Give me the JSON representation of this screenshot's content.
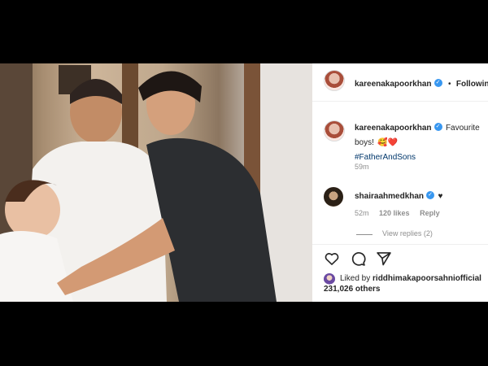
{
  "post": {
    "author": "kareenakapoorkhan",
    "follow_sep": "•",
    "follow_label": "Following"
  },
  "caption": {
    "author": "kareenakapoorkhan",
    "text": "Favourite boys!",
    "emoji1": "🥰",
    "emoji2": "❤️",
    "hashtag": "#FatherAndSons",
    "time": "59m"
  },
  "comment": {
    "author": "shairaahmedkhan",
    "text": "♥",
    "time": "52m",
    "likes": "120 likes",
    "reply": "Reply",
    "view_replies": "View replies (2)"
  },
  "likes": {
    "prefix": "Liked by",
    "user": "riddhimakapoorsahniofficial",
    "and_others": "231,026 others"
  },
  "icons": [
    "heart-icon",
    "comment-bubble-icon",
    "send-icon"
  ],
  "colors": {
    "link": "#00376b",
    "verified": "#3897f0",
    "heart": "#e0245e"
  }
}
